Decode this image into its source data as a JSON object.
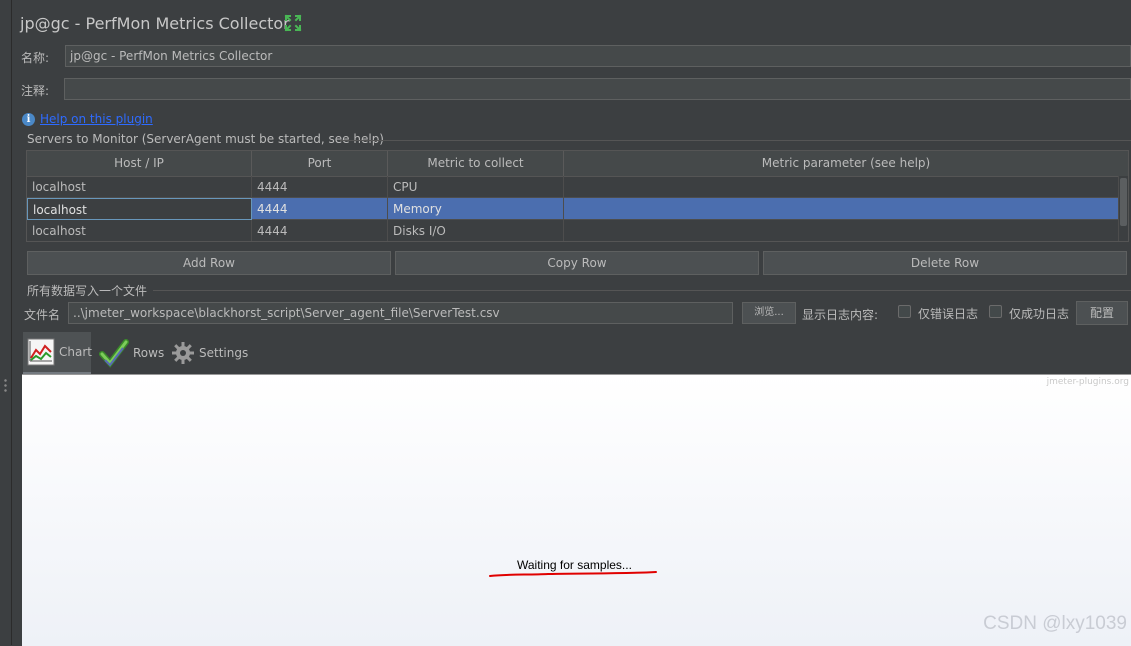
{
  "header": {
    "title": "jp@gc - PerfMon Metrics Collector",
    "expand_icon": "expand-arrows-icon"
  },
  "form": {
    "name_label": "名称:",
    "name_value": "jp@gc - PerfMon Metrics Collector",
    "comment_label": "注释:",
    "comment_value": ""
  },
  "help": {
    "icon": "info-icon",
    "link_text": "Help on this plugin"
  },
  "servers": {
    "group_title": "Servers to Monitor (ServerAgent must be started, see help)",
    "columns": [
      "Host / IP",
      "Port",
      "Metric to collect",
      "Metric parameter (see help)"
    ],
    "rows": [
      {
        "host": "localhost",
        "port": "4444",
        "metric": "CPU",
        "param": ""
      },
      {
        "host": "localhost",
        "port": "4444",
        "metric": "Memory",
        "param": ""
      },
      {
        "host": "localhost",
        "port": "4444",
        "metric": "Disks I/O",
        "param": ""
      }
    ],
    "selected_row": 1,
    "add_row": "Add Row",
    "copy_row": "Copy Row",
    "delete_row": "Delete Row"
  },
  "file": {
    "group_title": "所有数据写入一个文件",
    "filename_label": "文件名",
    "filename_value": "..\\jmeter_workspace\\blackhorst_script\\Server_agent_file\\ServerTest.csv",
    "browse_button": "浏览...",
    "log_label": "显示日志内容:",
    "errors_only": "仅错误日志",
    "success_only": "仅成功日志",
    "configure_button": "配置"
  },
  "tabs": [
    {
      "label": "Chart",
      "icon": "line-chart-icon",
      "active": true
    },
    {
      "label": "Rows",
      "icon": "checkmark-icon",
      "active": false
    },
    {
      "label": "Settings",
      "icon": "gear-icon",
      "active": false
    }
  ],
  "chart": {
    "site_watermark": "jmeter-plugins.org",
    "waiting_text": "Waiting for samples...",
    "annotation_color": "#e00000"
  },
  "watermark": "CSDN @lxy1039",
  "colors": {
    "background": "#3c3f41",
    "selection": "#4b6eaf",
    "link": "#2e6bff"
  }
}
